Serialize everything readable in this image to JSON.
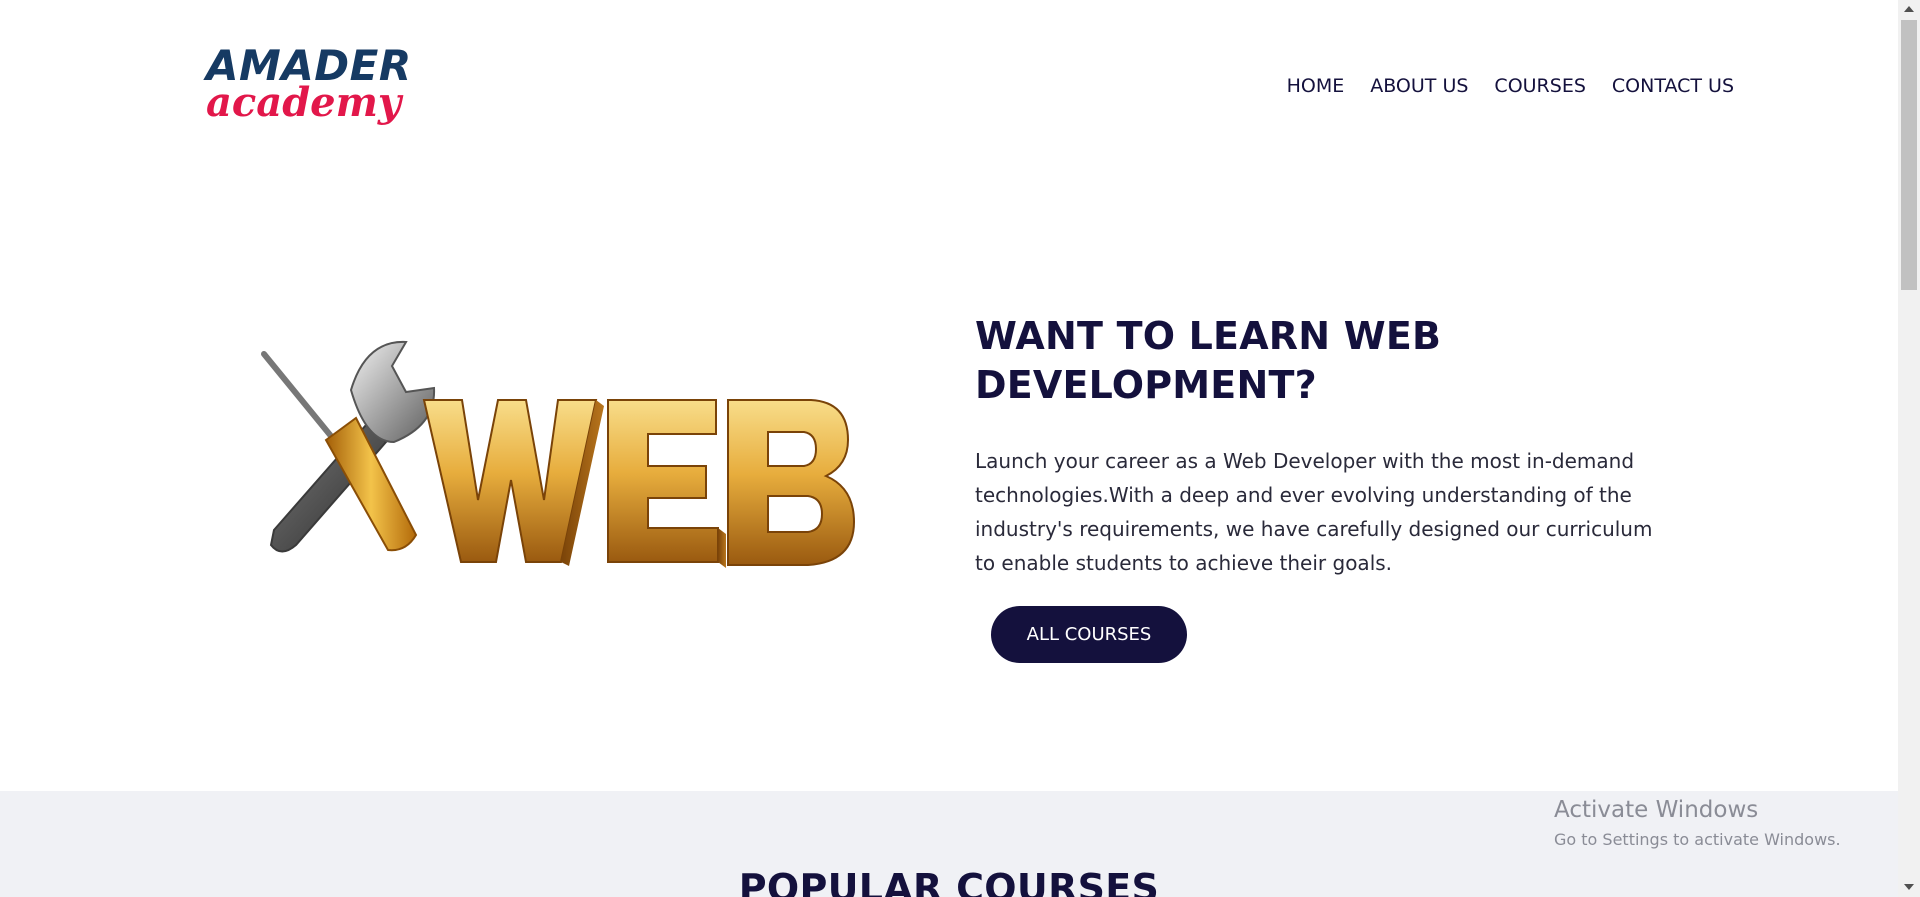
{
  "logo": {
    "line1": "AMADER",
    "line2": "academy"
  },
  "nav": {
    "items": [
      {
        "label": "HOME"
      },
      {
        "label": "ABOUT US"
      },
      {
        "label": "COURSES"
      },
      {
        "label": "CONTACT US"
      }
    ]
  },
  "hero": {
    "image_text": "WEB",
    "title_line1": "WANT TO LEARN WEB",
    "title_line2": "DEVELOPMENT?",
    "description": "Launch your career as a Web Developer with the most in-demand technologies.With a deep and ever evolving understanding of the industry's requirements, we have carefully designed our curriculum to enable students to achieve their goals.",
    "button_label": "ALL COURSES"
  },
  "popular": {
    "title": "POPULAR COURSES"
  },
  "watermark": {
    "title": "Activate Windows",
    "subtitle": "Go to Settings to activate Windows."
  },
  "colors": {
    "primary": "#14113d",
    "logo_blue": "#163a63",
    "logo_red": "#e2174a",
    "section_bg": "#f0f1f5"
  }
}
